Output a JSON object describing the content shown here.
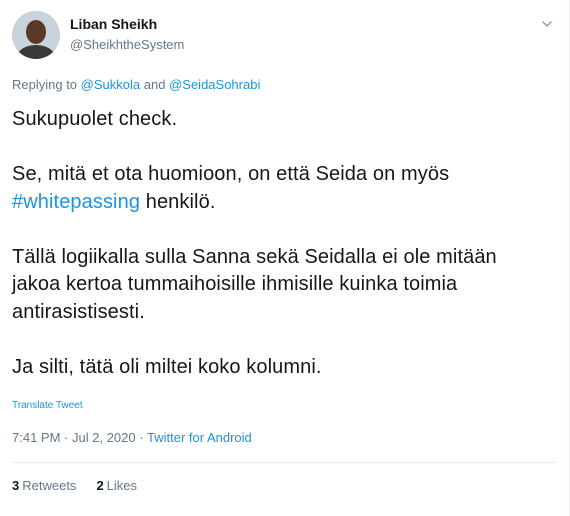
{
  "author": {
    "name": "Liban Sheikh",
    "handle": "@SheikhtheSystem"
  },
  "reply": {
    "prefix": "Replying to",
    "mention_1": "@Sukkola",
    "joiner": "and",
    "mention_2": "@SeidaSohrabi"
  },
  "body": {
    "p1": "Sukupuolet check.",
    "p2_line1": "Se, mitä et ota huomioon, on että Seida on myös",
    "p2_hashtag": "#whitepassing",
    "p2_after": "henkilö.",
    "p3_line1": "Tällä logiikalla sulla Sanna sekä Seidalla ei ole mitään",
    "p3_line2": "jakoa kertoa tummaihoisille ihmisille kuinka toimia",
    "p3_line3": "antirasistisesti.",
    "p4": "Ja silti, tätä oli miltei koko kolumni."
  },
  "translate_label": "Translate Tweet",
  "meta": {
    "time": "7:41 PM",
    "sep1": "·",
    "date": "Jul 2, 2020",
    "sep2": "·",
    "source": "Twitter for Android"
  },
  "stats": {
    "retweets_count": "3",
    "retweets_label": "Retweets",
    "likes_count": "2",
    "likes_label": "Likes"
  },
  "icons": {
    "caret": "chevron-down-icon"
  },
  "colors": {
    "link": "#1b95e0",
    "secondary": "#657786",
    "text": "#14171a"
  }
}
